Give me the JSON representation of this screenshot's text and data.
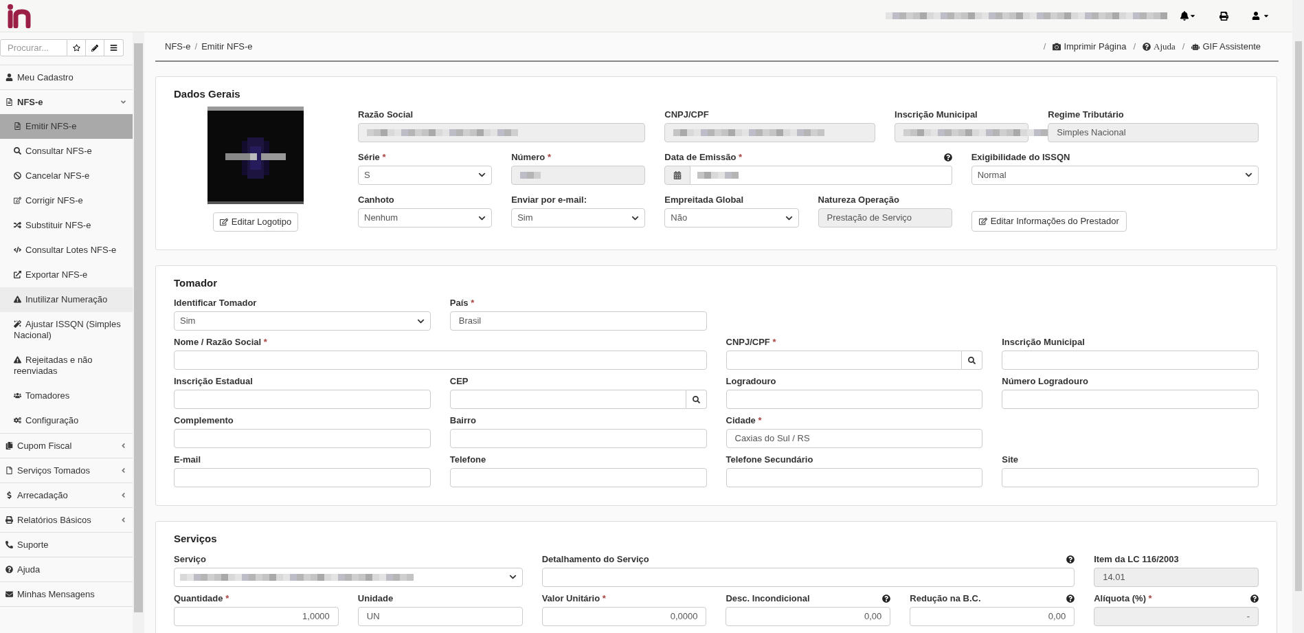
{
  "sidebar": {
    "search": {
      "placeholder": "Procurar..."
    },
    "items": [
      {
        "label": "Meu Cadastro"
      },
      {
        "label": "NFS-e",
        "expanded": true,
        "children": [
          {
            "label": "Emitir NFS-e",
            "selected": true,
            "highlighted": false
          },
          {
            "label": "Consultar NFS-e",
            "selected": false,
            "highlighted": false
          },
          {
            "label": "Cancelar NFS-e",
            "selected": false,
            "highlighted": false
          },
          {
            "label": "Corrigir NFS-e",
            "selected": false,
            "highlighted": false
          },
          {
            "label": "Substituir NFS-e",
            "selected": false,
            "highlighted": false
          },
          {
            "label": "Consultar Lotes NFS-e",
            "selected": false,
            "highlighted": false
          },
          {
            "label": "Exportar NFS-e",
            "selected": false,
            "highlighted": false
          },
          {
            "label": "Inutilizar Numeração",
            "selected": false,
            "highlighted": true
          },
          {
            "label": "Ajustar ISSQN (Simples Nacional)",
            "selected": false,
            "highlighted": false
          },
          {
            "label": "Rejeitadas e não reenviadas",
            "selected": false,
            "highlighted": false
          },
          {
            "label": "Tomadores",
            "selected": false,
            "highlighted": false
          },
          {
            "label": "Configuração",
            "selected": false,
            "highlighted": false
          }
        ]
      },
      {
        "label": "Cupom Fiscal",
        "expanded": false
      },
      {
        "label": "Serviços Tomados",
        "expanded": false
      },
      {
        "label": "Arrecadação",
        "expanded": false
      },
      {
        "label": "Relatórios Básicos",
        "expanded": false
      },
      {
        "label": "Suporte"
      },
      {
        "label": "Ajuda"
      },
      {
        "label": "Minhas Mensagens"
      }
    ]
  },
  "required_mark": "*",
  "breadcrumb": {
    "separator": "/",
    "items": [
      "NFS-e",
      "Emitir NFS-e"
    ]
  },
  "page_links": [
    "Imprimir Página",
    "Ajuda",
    "GIF Assistente"
  ],
  "dados_gerais": {
    "title": "Dados Gerais",
    "logo_button": "Editar Logotipo",
    "fields": [
      {
        "label": "Razão Social",
        "kind": "readonly",
        "required": false,
        "redacted": true
      },
      {
        "label": "CNPJ/CPF",
        "kind": "readonly",
        "required": false,
        "redacted": true
      },
      {
        "label": "Inscrição Municipal",
        "kind": "readonly",
        "required": false,
        "redacted": true
      },
      {
        "label": "Regime Tributário",
        "kind": "readonly",
        "required": false,
        "value": "Simples Nacional"
      },
      {
        "label": "Série",
        "kind": "select",
        "required": true,
        "value": "S"
      },
      {
        "label": "Número",
        "kind": "readonly",
        "required": true,
        "redacted": true
      },
      {
        "label": "Data de Emissão",
        "kind": "date",
        "required": true,
        "help": true,
        "redacted": true
      },
      {
        "label": "Exigibilidade do ISSQN",
        "kind": "select",
        "required": false,
        "value": "Normal"
      },
      {
        "label": "Canhoto",
        "kind": "select",
        "required": false,
        "value": "Nenhum"
      },
      {
        "label": "Enviar por e-mail:",
        "kind": "select",
        "required": false,
        "value": "Sim"
      },
      {
        "label": "Empreitada Global",
        "kind": "select",
        "required": false,
        "value": "Não"
      },
      {
        "label": "Natureza Operação",
        "kind": "readonly",
        "required": false,
        "value": "Prestação de Serviço"
      },
      {
        "kind": "button",
        "value": "Editar Informações do Prestador"
      }
    ]
  },
  "tomador": {
    "title": "Tomador",
    "fields": [
      {
        "label": "Identificar Tomador",
        "kind": "select",
        "required": false,
        "value": "Sim"
      },
      {
        "label": "País",
        "kind": "text",
        "required": true,
        "value": "Brasil"
      },
      {
        "label": "Nome / Razão Social",
        "kind": "text",
        "required": true
      },
      {
        "label": "CNPJ/CPF",
        "kind": "search",
        "required": true
      },
      {
        "label": "Inscrição Municipal",
        "kind": "text",
        "required": false
      },
      {
        "label": "Inscrição Estadual",
        "kind": "text",
        "required": false
      },
      {
        "label": "CEP",
        "kind": "search",
        "required": false
      },
      {
        "label": "Logradouro",
        "kind": "text",
        "required": false
      },
      {
        "label": "Número Logradouro",
        "kind": "text",
        "required": false
      },
      {
        "label": "Complemento",
        "kind": "text",
        "required": false
      },
      {
        "label": "Bairro",
        "kind": "text",
        "required": false
      },
      {
        "label": "Cidade",
        "kind": "text",
        "required": true,
        "value": "Caxias do Sul / RS"
      },
      {
        "label": "E-mail",
        "kind": "text",
        "required": false
      },
      {
        "label": "Telefone",
        "kind": "text",
        "required": false
      },
      {
        "label": "Telefone Secundário",
        "kind": "text",
        "required": false
      },
      {
        "label": "Site",
        "kind": "text",
        "required": false
      }
    ]
  },
  "servicos": {
    "title": "Serviços",
    "fields": [
      {
        "label": "Serviço",
        "kind": "select",
        "required": false,
        "redacted": true
      },
      {
        "label": "Detalhamento do Serviço",
        "kind": "text",
        "required": false,
        "help": true
      },
      {
        "label": "Item da LC 116/2003",
        "kind": "readonly",
        "required": false,
        "value": "14.01"
      },
      {
        "label": "Quantidade",
        "kind": "number",
        "required": true,
        "value": "1,0000"
      },
      {
        "label": "Unidade",
        "kind": "text",
        "required": false,
        "value": "UN"
      },
      {
        "label": "Valor Unitário",
        "kind": "number",
        "required": true,
        "value": "0,0000"
      },
      {
        "label": "Desc. Incondicional",
        "kind": "number",
        "required": false,
        "help": true,
        "value": "0,00"
      },
      {
        "label": "Redução na B.C.",
        "kind": "number",
        "required": false,
        "help": true,
        "value": "0,00"
      },
      {
        "label": "Alíquota (%)",
        "kind": "readonly_number",
        "required": true,
        "help": true,
        "value": "-"
      }
    ]
  }
}
